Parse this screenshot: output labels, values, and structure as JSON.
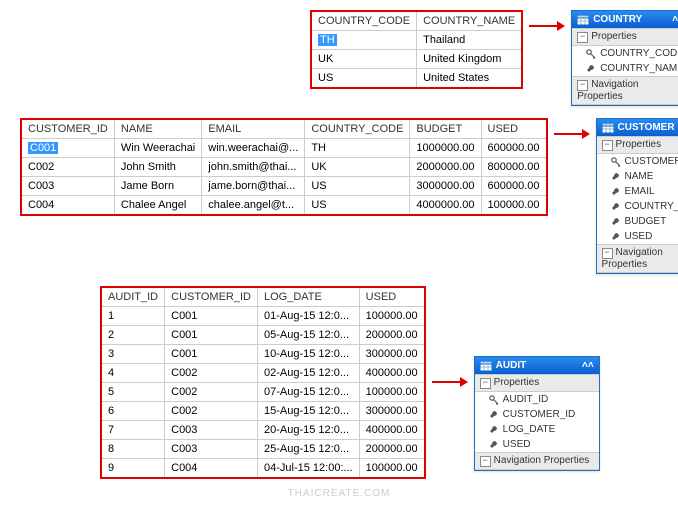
{
  "watermark": "THAICREATE.COM",
  "country_table": {
    "headers": [
      "COUNTRY_CODE",
      "COUNTRY_NAME"
    ],
    "rows": [
      {
        "code": "TH",
        "name": "Thailand",
        "selected": true
      },
      {
        "code": "UK",
        "name": "United Kingdom"
      },
      {
        "code": "US",
        "name": "United States"
      }
    ]
  },
  "customer_table": {
    "headers": [
      "CUSTOMER_ID",
      "NAME",
      "EMAIL",
      "COUNTRY_CODE",
      "BUDGET",
      "USED"
    ],
    "rows": [
      {
        "id": "C001",
        "name": "Win Weerachai",
        "email": "win.weerachai@...",
        "cc": "TH",
        "budget": "1000000.00",
        "used": "600000.00",
        "selected": true
      },
      {
        "id": "C002",
        "name": "John  Smith",
        "email": "john.smith@thai...",
        "cc": "UK",
        "budget": "2000000.00",
        "used": "800000.00"
      },
      {
        "id": "C003",
        "name": "Jame Born",
        "email": "jame.born@thai...",
        "cc": "US",
        "budget": "3000000.00",
        "used": "600000.00"
      },
      {
        "id": "C004",
        "name": "Chalee Angel",
        "email": "chalee.angel@t...",
        "cc": "US",
        "budget": "4000000.00",
        "used": "100000.00"
      }
    ]
  },
  "audit_table": {
    "headers": [
      "AUDIT_ID",
      "CUSTOMER_ID",
      "LOG_DATE",
      "USED"
    ],
    "rows": [
      {
        "id": "1",
        "cust": "C001",
        "date": "01-Aug-15 12:0...",
        "used": "100000.00"
      },
      {
        "id": "2",
        "cust": "C001",
        "date": "05-Aug-15 12:0...",
        "used": "200000.00"
      },
      {
        "id": "3",
        "cust": "C001",
        "date": "10-Aug-15 12:0...",
        "used": "300000.00"
      },
      {
        "id": "4",
        "cust": "C002",
        "date": "02-Aug-15 12:0...",
        "used": "400000.00"
      },
      {
        "id": "5",
        "cust": "C002",
        "date": "07-Aug-15 12:0...",
        "used": "100000.00"
      },
      {
        "id": "6",
        "cust": "C002",
        "date": "15-Aug-15 12:0...",
        "used": "300000.00"
      },
      {
        "id": "7",
        "cust": "C003",
        "date": "20-Aug-15 12:0...",
        "used": "400000.00"
      },
      {
        "id": "8",
        "cust": "C003",
        "date": "25-Aug-15 12:0...",
        "used": "200000.00"
      },
      {
        "id": "9",
        "cust": "C004",
        "date": "04-Jul-15 12:00:...",
        "used": "100000.00"
      }
    ]
  },
  "schemas": {
    "country": {
      "title": "COUNTRY",
      "sections": {
        "props": "Properties",
        "nav": "Navigation Properties"
      },
      "props": [
        {
          "name": "COUNTRY_CODE",
          "key": true
        },
        {
          "name": "COUNTRY_NAME",
          "key": false
        }
      ]
    },
    "customer": {
      "title": "CUSTOMER",
      "sections": {
        "props": "Properties",
        "nav": "Navigation Properties"
      },
      "props": [
        {
          "name": "CUSTOMER_ID",
          "key": true
        },
        {
          "name": "NAME",
          "key": false
        },
        {
          "name": "EMAIL",
          "key": false
        },
        {
          "name": "COUNTRY_CODE",
          "key": false
        },
        {
          "name": "BUDGET",
          "key": false
        },
        {
          "name": "USED",
          "key": false
        }
      ]
    },
    "audit": {
      "title": "AUDIT",
      "sections": {
        "props": "Properties",
        "nav": "Navigation Properties"
      },
      "props": [
        {
          "name": "AUDIT_ID",
          "key": true
        },
        {
          "name": "CUSTOMER_ID",
          "key": false
        },
        {
          "name": "LOG_DATE",
          "key": false
        },
        {
          "name": "USED",
          "key": false
        }
      ]
    }
  }
}
